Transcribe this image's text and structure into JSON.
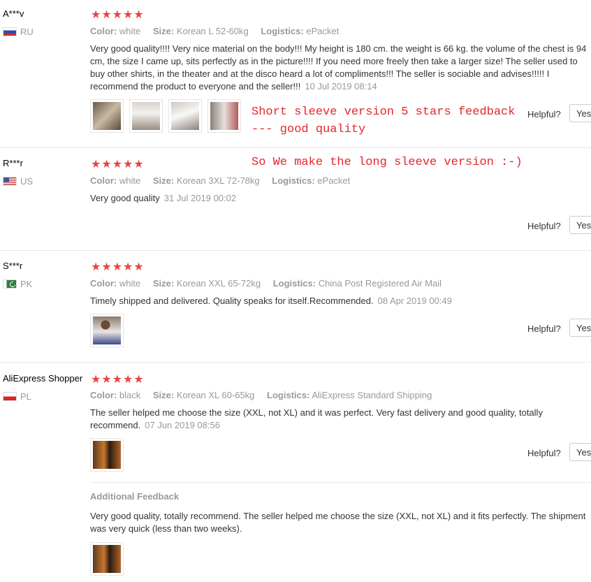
{
  "reviews": [
    {
      "user": "A***v",
      "country": "RU",
      "stars": "★★★★★",
      "color_label": "Color:",
      "color": "white",
      "size_label": "Size:",
      "size": "Korean L 52-60kg",
      "logistics_label": "Logistics:",
      "logistics": "ePacket",
      "text": "Very good quality!!!! Very nice material on the body!!! My height is 180 cm. the weight is 66 kg. the volume of the chest is 94 cm, the size I came up, sits perfectly as in the picture!!!! If you need more freely then take a larger size! The seller used to buy other shirts, in the theater and at the disco heard a lot of compliments!!! The seller is sociable and advises!!!!! I recommend the product to everyone and the seller!!!",
      "date": "10 Jul 2019 08:14",
      "helpful": "Helpful?",
      "yes": "Yes"
    },
    {
      "user": "R***r",
      "country": "US",
      "stars": "★★★★★",
      "color_label": "Color:",
      "color": "white",
      "size_label": "Size:",
      "size": "Korean 3XL 72-78kg",
      "logistics_label": "Logistics:",
      "logistics": "ePacket",
      "text": "Very good quality",
      "date": "31 Jul 2019 00:02",
      "helpful": "Helpful?",
      "yes": "Yes"
    },
    {
      "user": "S***r",
      "country": "PK",
      "stars": "★★★★★",
      "color_label": "Color:",
      "color": "white",
      "size_label": "Size:",
      "size": "Korean XXL 65-72kg",
      "logistics_label": "Logistics:",
      "logistics": "China Post Registered Air Mail",
      "text": "Timely shipped and delivered. Quality speaks for itself.Recommended.",
      "date": "08 Apr 2019 00:49",
      "helpful": "Helpful?",
      "yes": "Yes"
    },
    {
      "user": "AliExpress Shopper",
      "country": "PL",
      "stars": "★★★★★",
      "color_label": "Color:",
      "color": "black",
      "size_label": "Size:",
      "size": "Korean XL 60-65kg",
      "logistics_label": "Logistics:",
      "logistics": "AliExpress Standard Shipping",
      "text": "The seller helped me choose the size (XXL, not XL) and it was perfect. Very fast delivery and good quality, totally recommend.",
      "date": "07 Jun 2019 08:56",
      "helpful": "Helpful?",
      "yes": "Yes",
      "additional_title": "Additional Feedback",
      "additional_text": "Very good quality, totally recommend. The seller helped me choose the size (XXL, not XL) and it fits perfectly. The shipment was very quick (less than two weeks)."
    }
  ],
  "annotations": {
    "line1": "Short sleeve version 5 stars feedback",
    "line2": "--- good quality",
    "line3": "So We make the long sleeve version :-)"
  },
  "colors": {
    "stars": "#e64545",
    "annotation": "#e5262a",
    "muted": "#999999"
  }
}
